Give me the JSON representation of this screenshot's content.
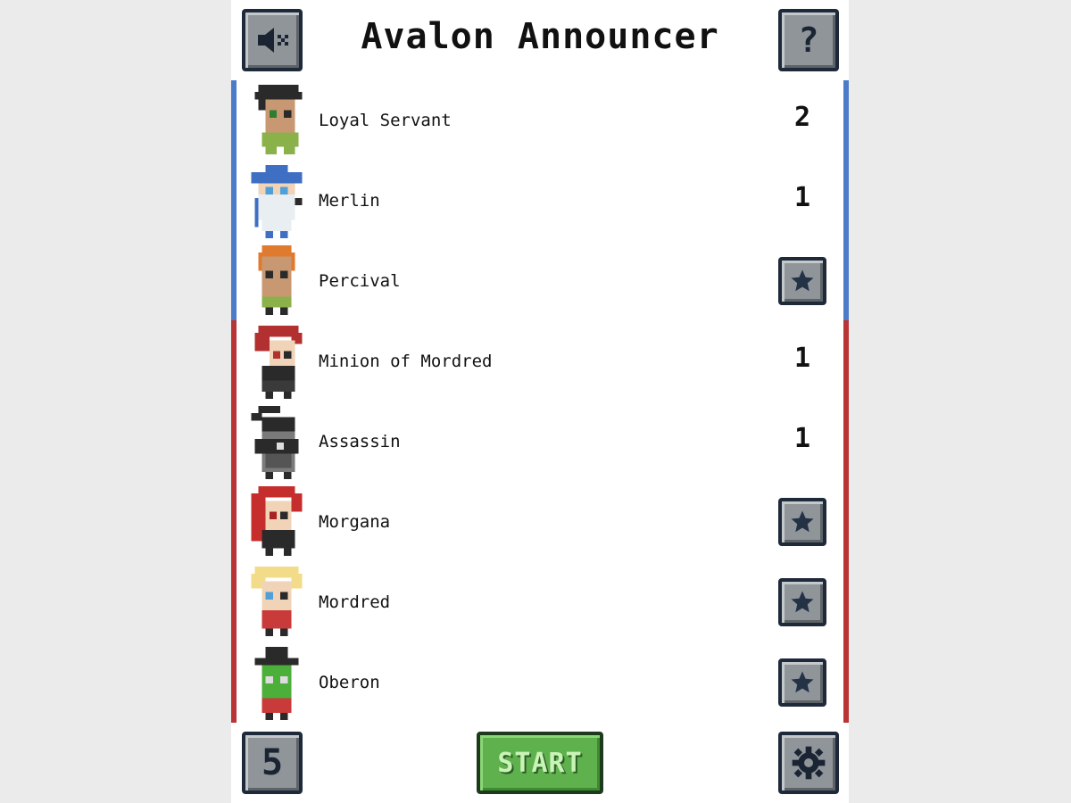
{
  "title": "Avalon Announcer",
  "header": {
    "mute_icon": "speaker-muted-icon",
    "help_label": "?"
  },
  "roles": [
    {
      "name": "Loyal Servant",
      "team": "good",
      "count": "2",
      "avatar": "loyal-servant-avatar"
    },
    {
      "name": "Merlin",
      "team": "good",
      "count": "1",
      "avatar": "merlin-avatar"
    },
    {
      "name": "Percival",
      "team": "good",
      "toggle": "star",
      "avatar": "percival-avatar"
    },
    {
      "name": "Minion of Mordred",
      "team": "evil",
      "count": "1",
      "avatar": "minion-avatar"
    },
    {
      "name": "Assassin",
      "team": "evil",
      "count": "1",
      "avatar": "assassin-avatar"
    },
    {
      "name": "Morgana",
      "team": "evil",
      "toggle": "star",
      "avatar": "morgana-avatar"
    },
    {
      "name": "Mordred",
      "team": "evil",
      "toggle": "star",
      "avatar": "mordred-avatar"
    },
    {
      "name": "Oberon",
      "team": "evil",
      "toggle": "star",
      "avatar": "oberon-avatar"
    }
  ],
  "footer": {
    "player_count": "5",
    "start_label": "START",
    "settings_icon": "gear-icon"
  },
  "colors": {
    "good_team": "#4c7cc9",
    "evil_team": "#b93434",
    "start_button": "#5fb14d",
    "button_gray": "#8f9599"
  }
}
